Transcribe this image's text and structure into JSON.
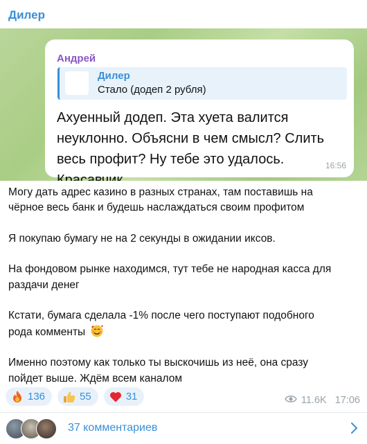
{
  "channel": {
    "title": "Дилер"
  },
  "forwarded_image": {
    "sender": "Андрей",
    "reply": {
      "name": "Дилер",
      "text": "Стало (додеп 2 рубля)"
    },
    "text": "Ахуенный додеп. Эта хуета валится\nнеуклонно. Объясни в чем смысл? Слить\nвесь профит? Ну тебе это удалось.\nКрасавчик.",
    "time": "16:56"
  },
  "post": {
    "paragraphs": {
      "p1": "Могу дать адрес казино в разных странах, там поставишь на\nчёрное весь банк и будешь наслаждаться своим профитом",
      "p2": "Я покупаю бумагу не на 2 секунды в ожидании иксов.",
      "p3": "На фондовом рынке находимся, тут тебе не народная касса для\nраздачи денег",
      "p4": "Кстати, бумага сделала -1% после чего поступают подобного\nрода комменты",
      "p5": "Именно поэтому как только ты выскочишь из неё, она сразу\nпойдет выше. Ждём всем каналом"
    },
    "inline_emoji": "smiling-face-with-hearts-icon"
  },
  "reactions": [
    {
      "icon": "fire-icon",
      "count": "136"
    },
    {
      "icon": "thumbs-up-icon",
      "count": "55"
    },
    {
      "icon": "heart-icon",
      "count": "31"
    }
  ],
  "meta": {
    "views": "11.6K",
    "time": "17:06",
    "views_icon": "eye-icon"
  },
  "comments": {
    "label": "37 комментариев",
    "icon": "chevron-right-icon"
  },
  "colors": {
    "accent": "#3a8fd6",
    "sender": "#8a56c4",
    "background_media": "#b4d493"
  }
}
